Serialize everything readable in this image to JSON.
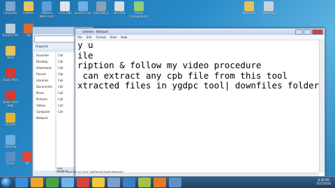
{
  "desktop_icons": [
    {
      "label": "Computer",
      "color": "#7aa7d6"
    },
    {
      "label": "Indexes",
      "color": "#e6c35c"
    },
    {
      "label": "VMware Multi Form",
      "color": "#5aa0d9"
    },
    {
      "label": "2-Flo_REK",
      "color": "#e0e4ea"
    },
    {
      "label": "Launch Cam",
      "color": "#6fb0e3"
    },
    {
      "label": "2022308_1",
      "color": "#8f9fb5"
    },
    {
      "label": "adv-REK",
      "color": "#d9dde4"
    },
    {
      "label": "Stand Components",
      "color": "#8fcf7a"
    },
    {
      "label": "New fold",
      "color": "#e5c15a"
    },
    {
      "label": "Bluemag",
      "color": "#c9d1dc"
    },
    {
      "label": "Recycle Bin",
      "color": "#b9cde0"
    },
    {
      "label": "Fox",
      "color": "#e06a2f"
    },
    {
      "label": "Ideas",
      "color": "#e6c35c"
    },
    {
      "label": "Quick Heal",
      "color": "#d33b2e"
    },
    {
      "label": "Quick Heal Help",
      "color": "#d33b2e"
    },
    {
      "label": "Chrome",
      "color": "#e0b536"
    },
    {
      "label": "Desktop",
      "color": "#6fb0e3"
    },
    {
      "label": "Driver",
      "color": "#5a8fc6"
    },
    {
      "label": "NIT",
      "color": "#d94a3a"
    }
  ],
  "explorer": {
    "organize": "Organize",
    "nav_items": [
      "Favorites",
      "Desktop",
      "Downloads",
      "Recent",
      "Libraries",
      "Documents",
      "Music",
      "Pictures",
      "Videos",
      "Computer",
      "Network"
    ],
    "main_items": [
      "Call",
      "Call",
      "Call",
      "Call",
      "Call",
      "Call",
      "Call",
      "Call",
      "Call",
      "Call"
    ],
    "status_name": "Size",
    "status_value": "21,05,04"
  },
  "notepad": {
    "title": "Untitled - Notepad",
    "menu": [
      "File",
      "Edit",
      "Format",
      "View",
      "Help"
    ],
    "lines": [
      "y u",
      "ile",
      "ription & follow my video procedure",
      " can extract any cpb file from this tool",
      "xtracted files in ygdpc tool| downfiles folder"
    ]
  },
  "footer_text": "©2012 Copyright (c) 2012 CoolPad All Rights Reserved",
  "taskbar": {
    "time": "8:36 PM",
    "date": "5/21/2016",
    "buttons": [
      "#3a8fd8",
      "#e8a531",
      "#4aa247",
      "#6cb5e8",
      "#d9443a",
      "#f0c83e",
      "#7aa1c9",
      "#3e7fc1",
      "#a3c24a",
      "#e07b2c",
      "#5c92c8"
    ]
  }
}
